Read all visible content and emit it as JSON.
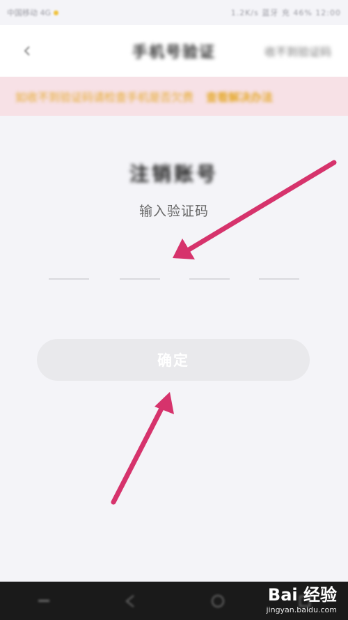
{
  "status_bar": {
    "left_text": "中国移动 4G",
    "right_text": "1.2K/s 蓝牙 充 46% 12:00"
  },
  "nav": {
    "title": "手机号验证",
    "right_label": "收不到验证码"
  },
  "notice": {
    "text": "如收不到验证码请检查手机是否欠费",
    "link": "查看解决办法"
  },
  "page": {
    "title": "注销账号",
    "subtitle": "输入验证码",
    "code_length": 4,
    "confirm_label": "确定"
  },
  "watermark": {
    "brand": "Bai 经验",
    "url": "jingyan.baidu.com"
  },
  "colors": {
    "arrow": "#d6336c",
    "notice_bg": "#f7e1e6",
    "button_bg": "#e9e9ec"
  }
}
